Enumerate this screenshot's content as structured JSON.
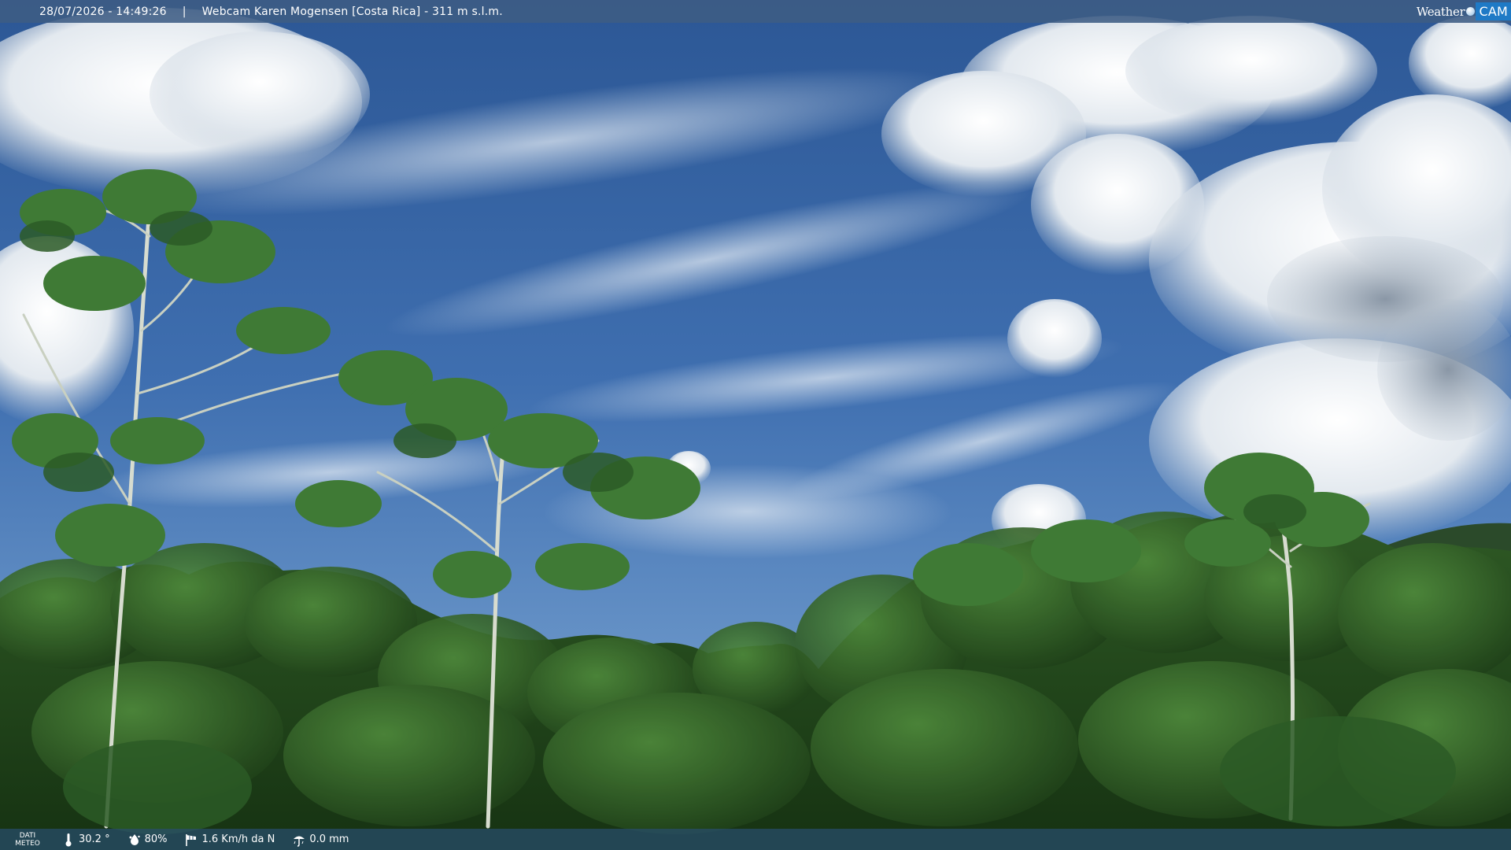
{
  "overlay": {
    "datetime": "28/07/2026 - 14:49:26",
    "separator": "|",
    "title": "Webcam Karen Mogensen [Costa Rica]  - 311 m s.l.m.",
    "brand": {
      "weather": "Weather",
      "cam": "CAM"
    }
  },
  "meteo": {
    "label_line1": "DATI",
    "label_line2": "METEO",
    "temperature": "30.2 °",
    "humidity": "80%",
    "wind": "1.6 Km/h da N",
    "rain": "0.0 mm"
  },
  "icons": {
    "temperature": "thermometer-icon",
    "humidity": "humidity-drop-icon",
    "wind": "windsock-icon",
    "rain": "rain-gauge-icon"
  },
  "colors": {
    "sky_top": "#2f5c9c",
    "sky_bottom": "#5a8ac4",
    "cloud": "#eef2f6",
    "forest_dark": "#1b3a16",
    "forest_mid": "#2f5a22",
    "brand_blue": "#1f7ac6"
  }
}
